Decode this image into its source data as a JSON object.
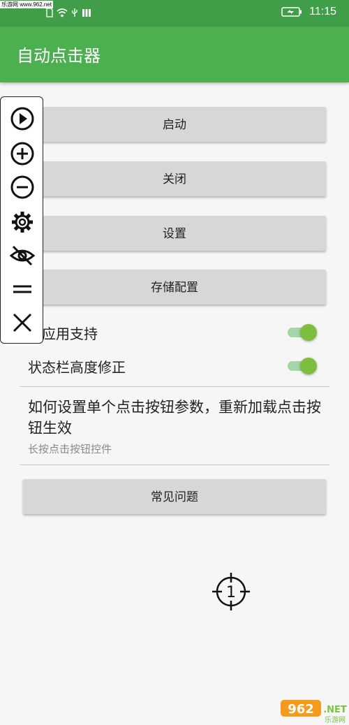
{
  "status_bar": {
    "watermark": "乐游网 www.962.net",
    "time": "11:15",
    "icons": [
      "sim-icon",
      "wifi-icon",
      "usb-icon",
      "battery-icon"
    ]
  },
  "app": {
    "title": "自动点击器",
    "accent": "#4caf50",
    "status_color": "#3f9e47"
  },
  "buttons": {
    "start": "启动",
    "close": "关闭",
    "settings": "设置",
    "save_config": "存储配置",
    "faq": "常见问题"
  },
  "settings": [
    {
      "label": "跨应用支持",
      "enabled": true
    },
    {
      "label": "状态栏高度修正",
      "enabled": true
    }
  ],
  "info": {
    "title": "如何设置单个点击按钮参数，重新加载点击按钮生效",
    "subtitle": "长按点击按钮控件"
  },
  "floating_toolbar": {
    "icons": [
      "play-icon",
      "add-icon",
      "remove-icon",
      "settings-icon",
      "hide-icon",
      "menu-icon",
      "close-icon"
    ]
  },
  "click_target": {
    "number": "1"
  },
  "logo": {
    "text": "962",
    "suffix": ".NET",
    "sub": "乐游网"
  }
}
